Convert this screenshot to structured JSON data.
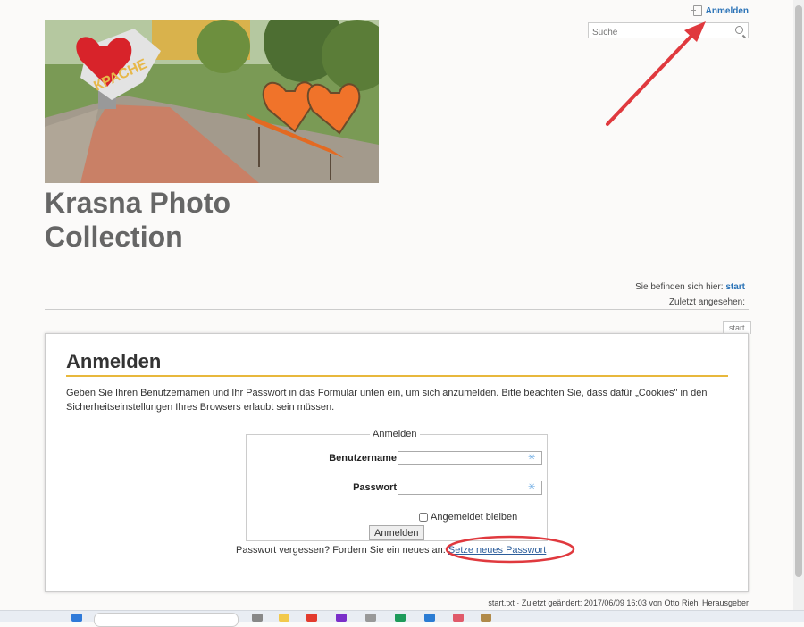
{
  "header": {
    "login_link": "Anmelden",
    "search_placeholder": "Suche"
  },
  "site": {
    "title_line1": "Krasna Photo",
    "title_line2": "Collection",
    "hero_sign_text": "КРАСНЕ"
  },
  "breadcrumbs": {
    "trace_label": "Sie befinden sich hier:",
    "trace_page": "start",
    "last_viewed": "Zuletzt angesehen:"
  },
  "page_tab": "start",
  "login": {
    "heading": "Anmelden",
    "intro": "Geben Sie Ihren Benutzernamen und Ihr Passwort in das Formular unten ein, um sich anzumelden. Bitte beachten Sie, dass dafür „Cookies\" in den Sicherheitseinstellungen Ihres Browsers erlaubt sein müssen.",
    "legend": "Anmelden",
    "username_label": "Benutzername",
    "password_label": "Passwort",
    "remember_label": "Angemeldet bleiben",
    "submit_label": "Anmelden",
    "forgot_text": "Passwort vergessen? Fordern Sie ein neues an:",
    "reset_link": "Setze neues Passwort"
  },
  "footer": {
    "text": "start.txt · Zuletzt geändert: 2017/06/09 16:03 von Otto Riehl Herausgeber"
  },
  "colors": {
    "link": "#2b73b7",
    "heading_rule": "#e8b83c",
    "annotation": "#e0393e"
  }
}
